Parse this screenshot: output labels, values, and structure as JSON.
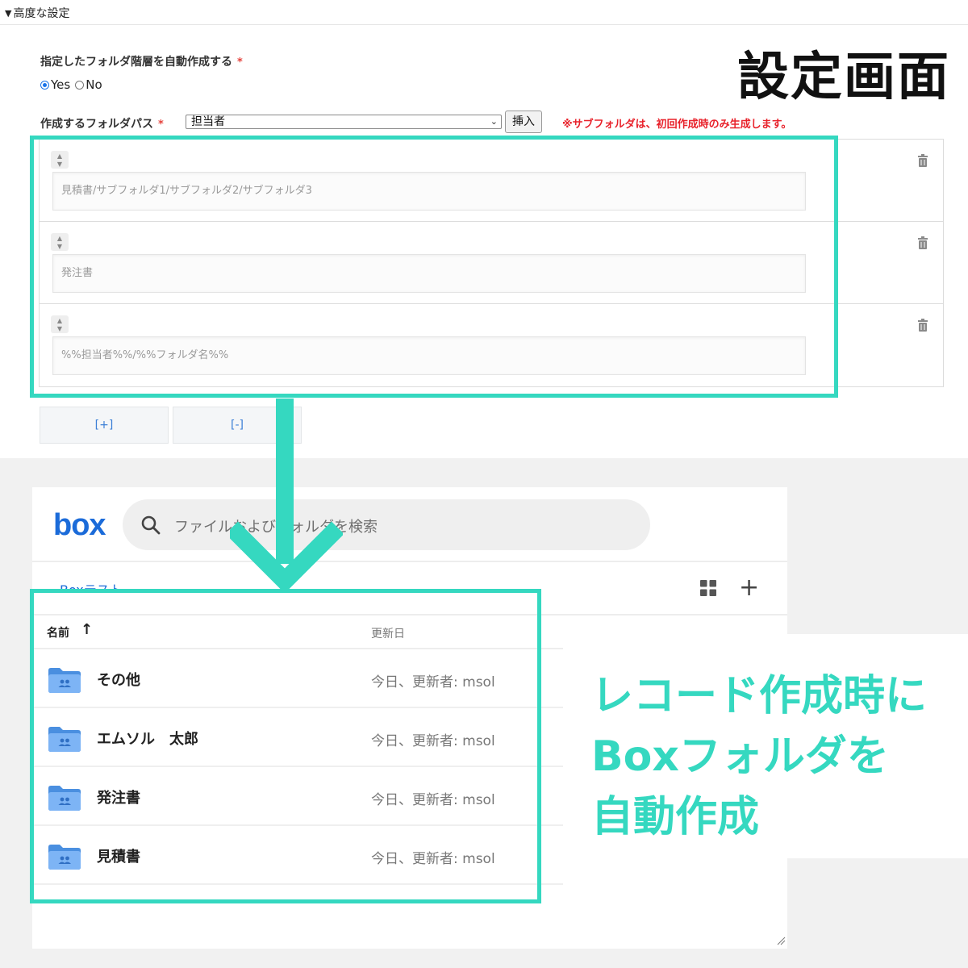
{
  "advanced": {
    "toggle": "▼",
    "title": "高度な設定"
  },
  "settings": {
    "auto_create_label": "指定したフォルダ階層を自動作成する",
    "required_mark": "*",
    "radio_yes": "Yes",
    "radio_no": "No",
    "radio_selected": "Yes",
    "path_label": "作成するフォルダパス",
    "select_value": "担当者",
    "insert_button": "挿入",
    "notice": "※サブフォルダは、初回作成時のみ生成します。",
    "paths": [
      {
        "placeholder": "見積書/サブフォルダ1/サブフォルダ2/サブフォルダ3"
      },
      {
        "placeholder": "発注書"
      },
      {
        "placeholder": "%%担当者%%/%%フォルダ名%%"
      }
    ],
    "add_button": "[+]",
    "remove_button": "[-]"
  },
  "screen_title": "設定画面",
  "box": {
    "logo": "box",
    "search_placeholder": "ファイルおよびフォルダを検索",
    "breadcrumb": "Boxテスト",
    "columns": {
      "name": "名前",
      "sort_arrow": "↑",
      "updated": "更新日"
    },
    "folders": [
      {
        "name": "その他",
        "updated": "今日、更新者: msol"
      },
      {
        "name": "エムソル　太郎",
        "updated": "今日、更新者: msol"
      },
      {
        "name": "発注書",
        "updated": "今日、更新者: msol"
      },
      {
        "name": "見積書",
        "updated": "今日、更新者: msol"
      }
    ]
  },
  "callout": {
    "lines": [
      "レコード作成時に",
      "Boxフォルダを",
      "自動作成"
    ]
  },
  "colors": {
    "accent_teal": "#35d8c0",
    "notice_red": "#e8222b",
    "box_blue": "#1b6bd9",
    "folder_blue": "#5aa0f0"
  }
}
